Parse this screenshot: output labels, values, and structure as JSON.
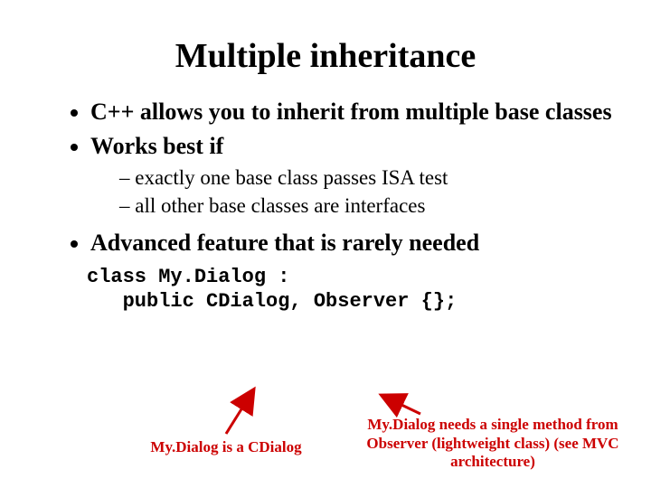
{
  "title": "Multiple inheritance",
  "bullets": {
    "b1": "C++ allows you to inherit from multiple base classes",
    "b2": "Works best if",
    "s1": "exactly one base class passes ISA test",
    "s2": "all other base classes are interfaces",
    "b3": "Advanced feature that is rarely needed"
  },
  "code": "class My.Dialog :\n   public CDialog, Observer {};",
  "annot": {
    "left": "My.Dialog is a CDialog",
    "right": "My.Dialog needs a single method from Observer (lightweight class) (see MVC architecture)"
  },
  "colors": {
    "annotation": "#cc0000"
  }
}
